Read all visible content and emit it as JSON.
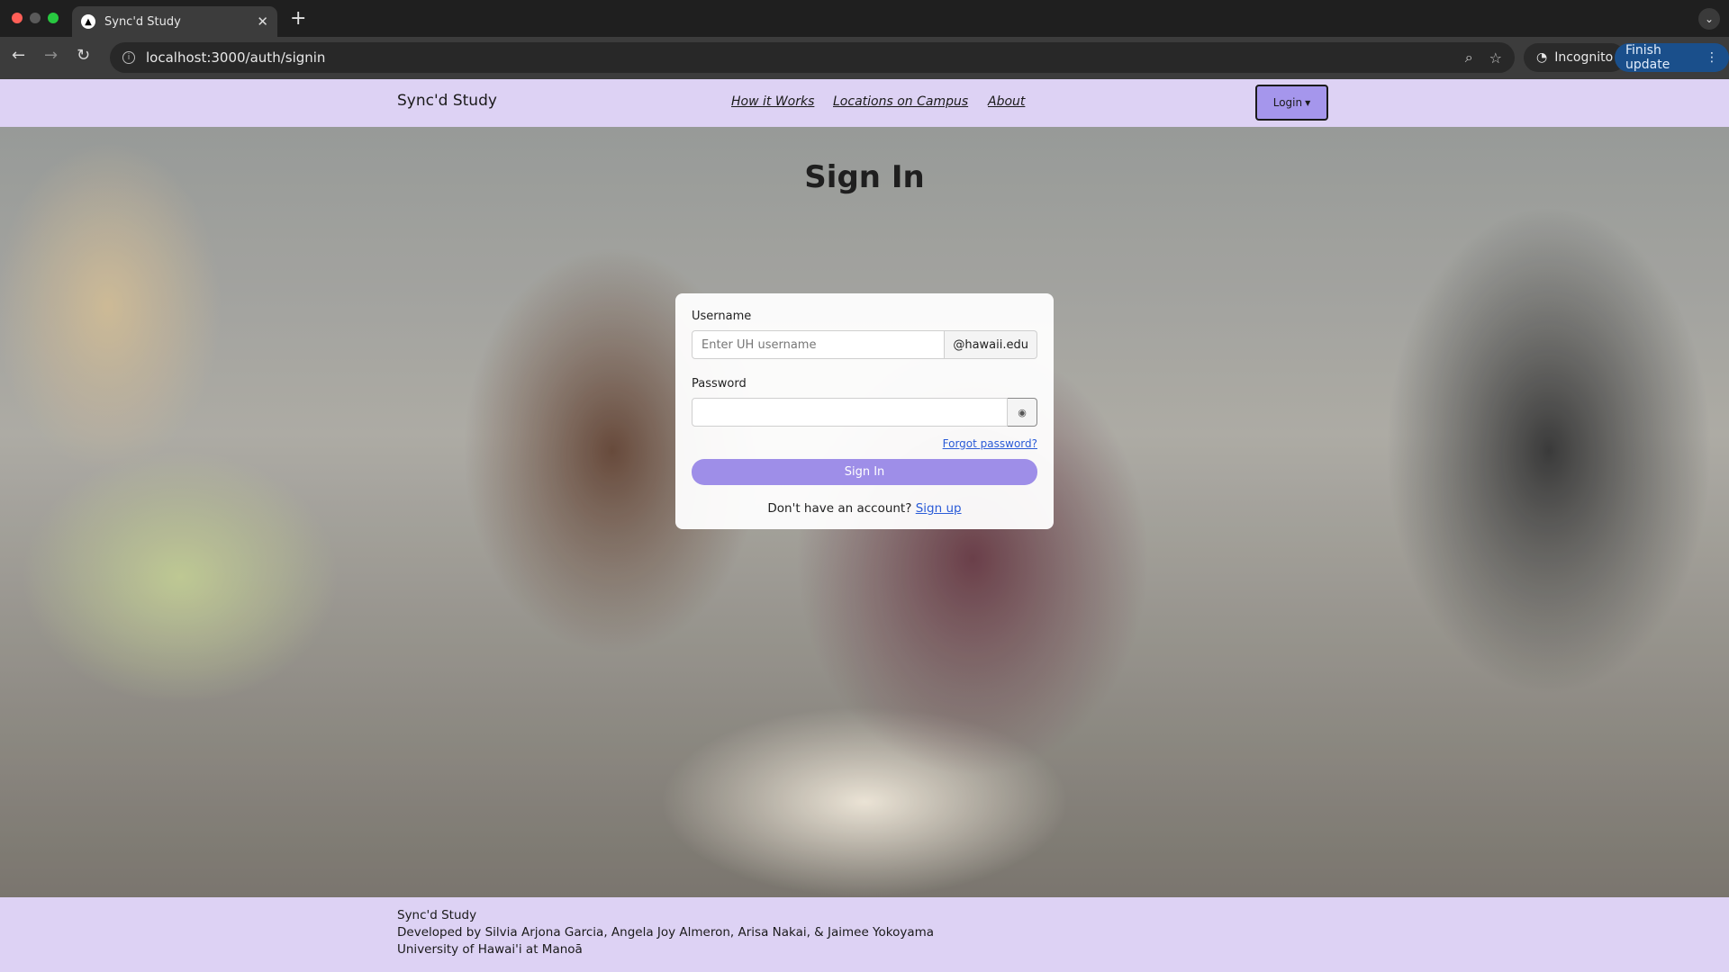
{
  "browser": {
    "tab_title": "Sync'd Study",
    "url": "localhost:3000/auth/signin",
    "incognito_label": "Incognito",
    "update_label": "Finish update"
  },
  "navbar": {
    "brand": "Sync'd Study",
    "links": [
      "How it Works",
      "Locations on Campus",
      "About"
    ],
    "login_label": "Login"
  },
  "signin": {
    "title": "Sign In",
    "username_label": "Username",
    "username_placeholder": "Enter UH username",
    "username_suffix": "@hawaii.edu",
    "password_label": "Password",
    "password_value": "",
    "forgot_label": "Forgot password?",
    "submit_label": "Sign In",
    "no_account_text": "Don't have an account?",
    "signup_label": "Sign up"
  },
  "footer": {
    "line1": "Sync'd Study",
    "line2": "Developed by Silvia Arjona Garcia, Angela Joy Almeron, Arisa Nakai, & Jaimee Yokoyama",
    "line3": "University of Hawai'i at Manoā"
  },
  "colors": {
    "nav_bg": "#ddd2f4",
    "accent": "#9e8ee8",
    "link": "#2a5bd7"
  }
}
